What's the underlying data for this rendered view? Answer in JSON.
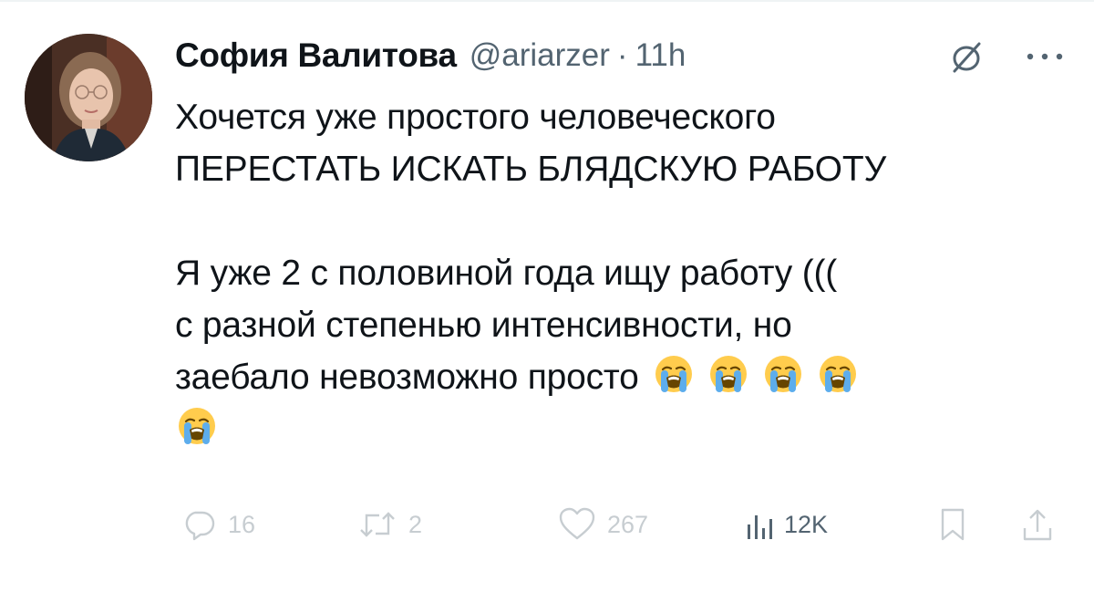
{
  "tweet": {
    "author": {
      "display_name": "София Валитова",
      "handle": "@ariarzer",
      "time": "11h",
      "avatar_icon": "user-avatar-photo"
    },
    "text_lines": [
      "Хочется уже простого человеческого",
      "ПЕРЕСТАТЬ ИСКАТЬ БЛЯДСКУЮ РАБОТУ",
      "",
      "Я уже 2 с половиной года ищу работу (((",
      "с разной степенью интенсивности, но",
      "заебало невозможно просто"
    ],
    "emoji": "loudly-crying-face",
    "emoji_count": 5,
    "header_icons": [
      "grok-icon",
      "more-icon"
    ],
    "actions": {
      "reply": {
        "icon": "reply-icon",
        "count": "16"
      },
      "retweet": {
        "icon": "retweet-icon",
        "count": "2"
      },
      "like": {
        "icon": "heart-icon",
        "count": "267"
      },
      "views": {
        "icon": "analytics-icon",
        "count": "12K"
      },
      "bookmark": {
        "icon": "bookmark-icon"
      },
      "share": {
        "icon": "share-icon"
      }
    },
    "colors": {
      "text": "#0f1419",
      "secondary": "#536471",
      "faded_action": "#c7cdd1",
      "emoji_face": "#ffcc4d",
      "emoji_tears": "#5dadec"
    }
  }
}
